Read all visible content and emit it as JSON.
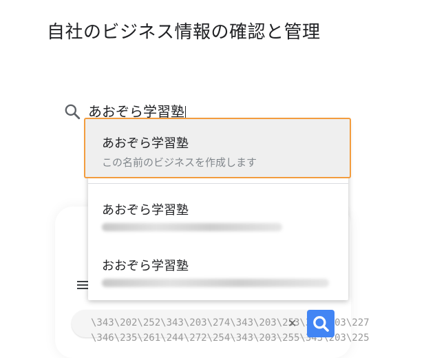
{
  "page": {
    "title": "自社のビジネス情報の確認と管理"
  },
  "search": {
    "value": "あおぞら学習塾",
    "icon": "search-icon"
  },
  "dropdown": {
    "create_option": {
      "name": "あおぞら学習塾",
      "subtitle": "この名前のビジネスを作成します"
    },
    "results": [
      {
        "name": "あおぞら学習塾"
      },
      {
        "name": "おおぞら学習塾"
      }
    ]
  },
  "background_phone": {
    "search_text": "\\343\\202\\252\\343\\203\\274\\343\\203\\253\\343\\203\\227",
    "search_text_2": "\\346\\235\\261\\244\\272\\254\\343\\203\\255\\343\\203\\225",
    "clear_symbol": "✕",
    "search_button_color": "#4285f4"
  },
  "colors": {
    "highlight_border": "#f39c3d",
    "highlight_bg": "#efefef"
  }
}
